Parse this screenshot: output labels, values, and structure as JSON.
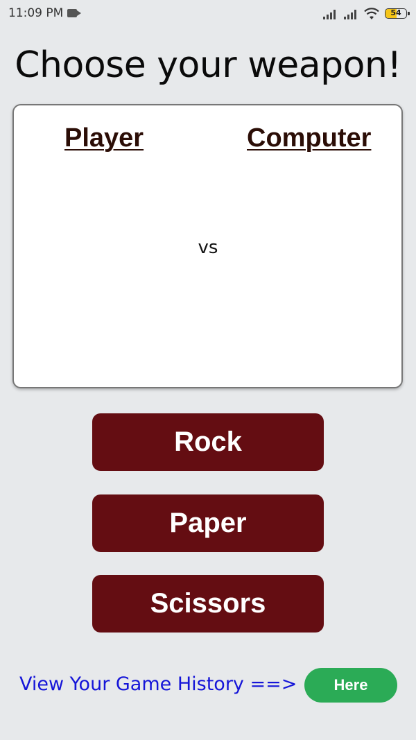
{
  "status_bar": {
    "time": "11:09 PM",
    "battery_level": "54",
    "icons": [
      "video-record-icon",
      "cell-signal-icon",
      "cell-signal-icon",
      "wifi-icon",
      "battery-icon"
    ]
  },
  "title": "Choose your weapon!",
  "arena": {
    "player_label": "Player",
    "computer_label": "Computer",
    "vs_text": "vs"
  },
  "weapons": {
    "rock": "Rock",
    "paper": "Paper",
    "scissors": "Scissors"
  },
  "history": {
    "text": "View Your Game History ==>",
    "button_label": "Here"
  },
  "colors": {
    "background": "#e7e9eb",
    "weapon_button": "#640d12",
    "here_button": "#2bab56",
    "history_link": "#1515d8",
    "label_color": "#2b0d06"
  }
}
